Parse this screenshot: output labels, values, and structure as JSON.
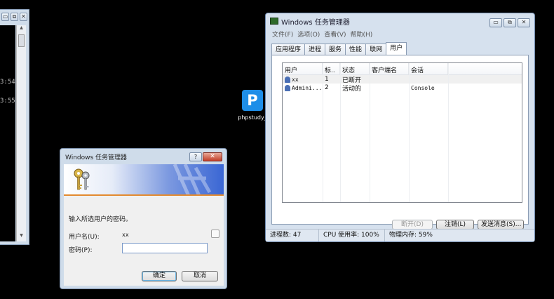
{
  "console": {
    "controls": [
      "▭",
      "⧉",
      "✕"
    ],
    "lines": [
      "3:54",
      "3:55"
    ],
    "scroll_up": "▲",
    "scroll_down": "▼"
  },
  "desktop_icon": {
    "glyph": "P",
    "label": "phpstudy_",
    "color": "#1e8ee8"
  },
  "task_manager": {
    "title": "Windows 任务管理器",
    "controls": [
      "▭",
      "⧉",
      "✕"
    ],
    "menu": [
      "文件(F)",
      "选项(O)",
      "查看(V)",
      "帮助(H)"
    ],
    "tabs": [
      "应用程序",
      "进程",
      "服务",
      "性能",
      "联网",
      "用户"
    ],
    "active_tab": "用户",
    "columns": [
      "用户",
      "标..",
      "状态",
      "客户端名",
      "会话"
    ],
    "rows": [
      {
        "user": "xx",
        "id": "1",
        "state": "已断开",
        "client": "",
        "session": ""
      },
      {
        "user": "Admini...",
        "id": "2",
        "state": "活动的",
        "client": "",
        "session": "Console"
      }
    ],
    "buttons": {
      "disconnect": "断开(D)",
      "logoff": "注销(L)",
      "send_message": "发送消息(S)..."
    },
    "status": {
      "processes": "进程数: 47",
      "cpu": "CPU 使用率: 100%",
      "memory": "物理内存: 59%"
    }
  },
  "dialog": {
    "title": "Windows 任务管理器",
    "help": "?",
    "close": "✕",
    "prompt": "输入所选用户的密码。",
    "username_label": "用户名(U):",
    "username_value": "xx",
    "password_label": "密码(P):",
    "password_value": "",
    "ok": "确定",
    "cancel": "取消",
    "accent": "#e38a2f"
  }
}
